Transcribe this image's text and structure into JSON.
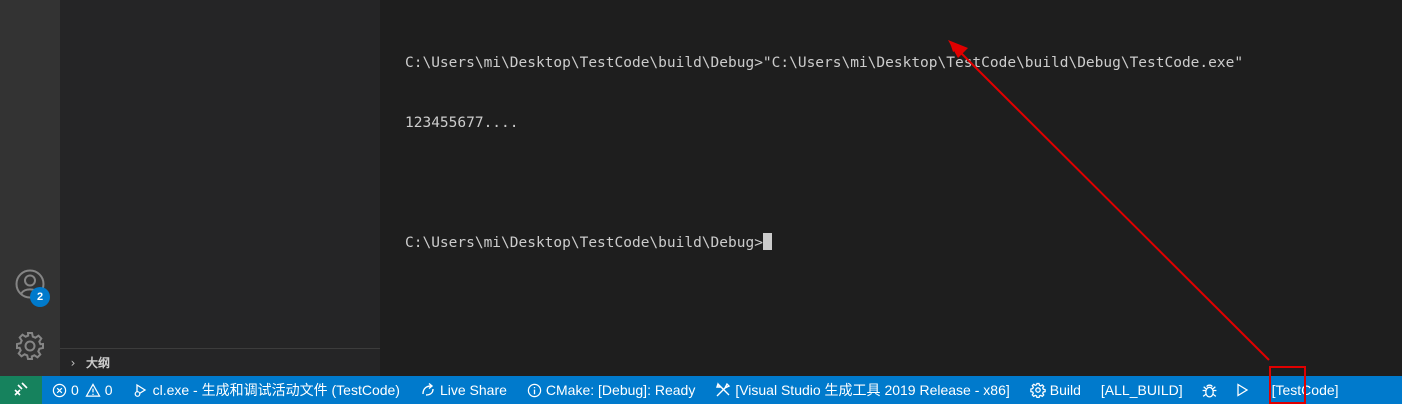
{
  "terminal": {
    "line1": "C:\\Users\\mi\\Desktop\\TestCode\\build\\Debug>\"C:\\Users\\mi\\Desktop\\TestCode\\build\\Debug\\TestCode.exe\"",
    "line2": "123455677....",
    "line3": "",
    "line4": "C:\\Users\\mi\\Desktop\\TestCode\\build\\Debug>"
  },
  "sidebar": {
    "outline_label": "大纲"
  },
  "activitybar": {
    "accounts_badge": "2"
  },
  "statusbar": {
    "errors": "0",
    "warnings": "0",
    "active_file": "cl.exe - 生成和调试活动文件 (TestCode)",
    "live_share": "Live Share",
    "cmake_status": "CMake: [Debug]: Ready",
    "kit": "[Visual Studio 生成工具 2019 Release - x86]",
    "build": "Build",
    "build_target": "[ALL_BUILD]",
    "launch_target": "[TestCode]"
  },
  "colors": {
    "statusbar": "#007acc",
    "remote": "#16825d",
    "annotation": "#e00000"
  },
  "icons": [
    "remote-icon",
    "error-icon",
    "warning-icon",
    "debug-config-icon",
    "live-share-icon",
    "info-icon",
    "tools-icon",
    "gear-icon",
    "bug-icon",
    "play-icon",
    "accounts-icon",
    "manage-gear-icon",
    "chevron-right-icon"
  ]
}
